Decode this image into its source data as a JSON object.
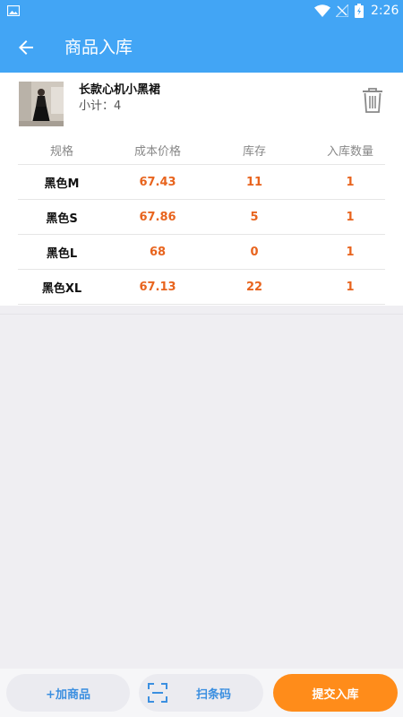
{
  "status_bar": {
    "time": "2:26"
  },
  "app_bar": {
    "title": "商品入库"
  },
  "product": {
    "name": "长款心机小黑裙",
    "subtotal": "小计：4"
  },
  "table": {
    "headers": [
      "规格",
      "成本价格",
      "库存",
      "入库数量"
    ],
    "rows": [
      {
        "spec": "黑色M",
        "cost": "67.43",
        "stock": "11",
        "qty": "1"
      },
      {
        "spec": "黑色S",
        "cost": "67.86",
        "stock": "5",
        "qty": "1"
      },
      {
        "spec": "黑色L",
        "cost": "68",
        "stock": "0",
        "qty": "1"
      },
      {
        "spec": "黑色XL",
        "cost": "67.13",
        "stock": "22",
        "qty": "1"
      }
    ]
  },
  "bottom_bar": {
    "add_label": "+加商品",
    "scan_label": "扫条码",
    "submit_label": "提交入库"
  },
  "colors": {
    "primary": "#42a5f5",
    "accent_orange": "#ff8c1a",
    "value_orange": "#e8641e",
    "link_blue": "#3b8fe0"
  }
}
